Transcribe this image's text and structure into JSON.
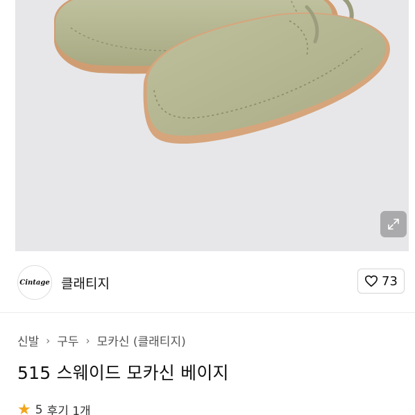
{
  "shop": {
    "logo_text": "Cintage",
    "name": "클래티지",
    "like_count": "73"
  },
  "breadcrumb": [
    "신발",
    "구두",
    "모카신 (클래티지)"
  ],
  "product": {
    "title": "515 스웨이드 모카신 베이지"
  },
  "rating": {
    "score": "5",
    "reviews": "후기 1개"
  },
  "colors": {
    "photo_bg": "#e7e7e9",
    "suede": "#b6b893",
    "sole": "#c9966a",
    "star": "#f2a51a"
  },
  "icons": [
    "expand-icon",
    "heart-icon",
    "chevron-right-icon",
    "star-icon"
  ]
}
